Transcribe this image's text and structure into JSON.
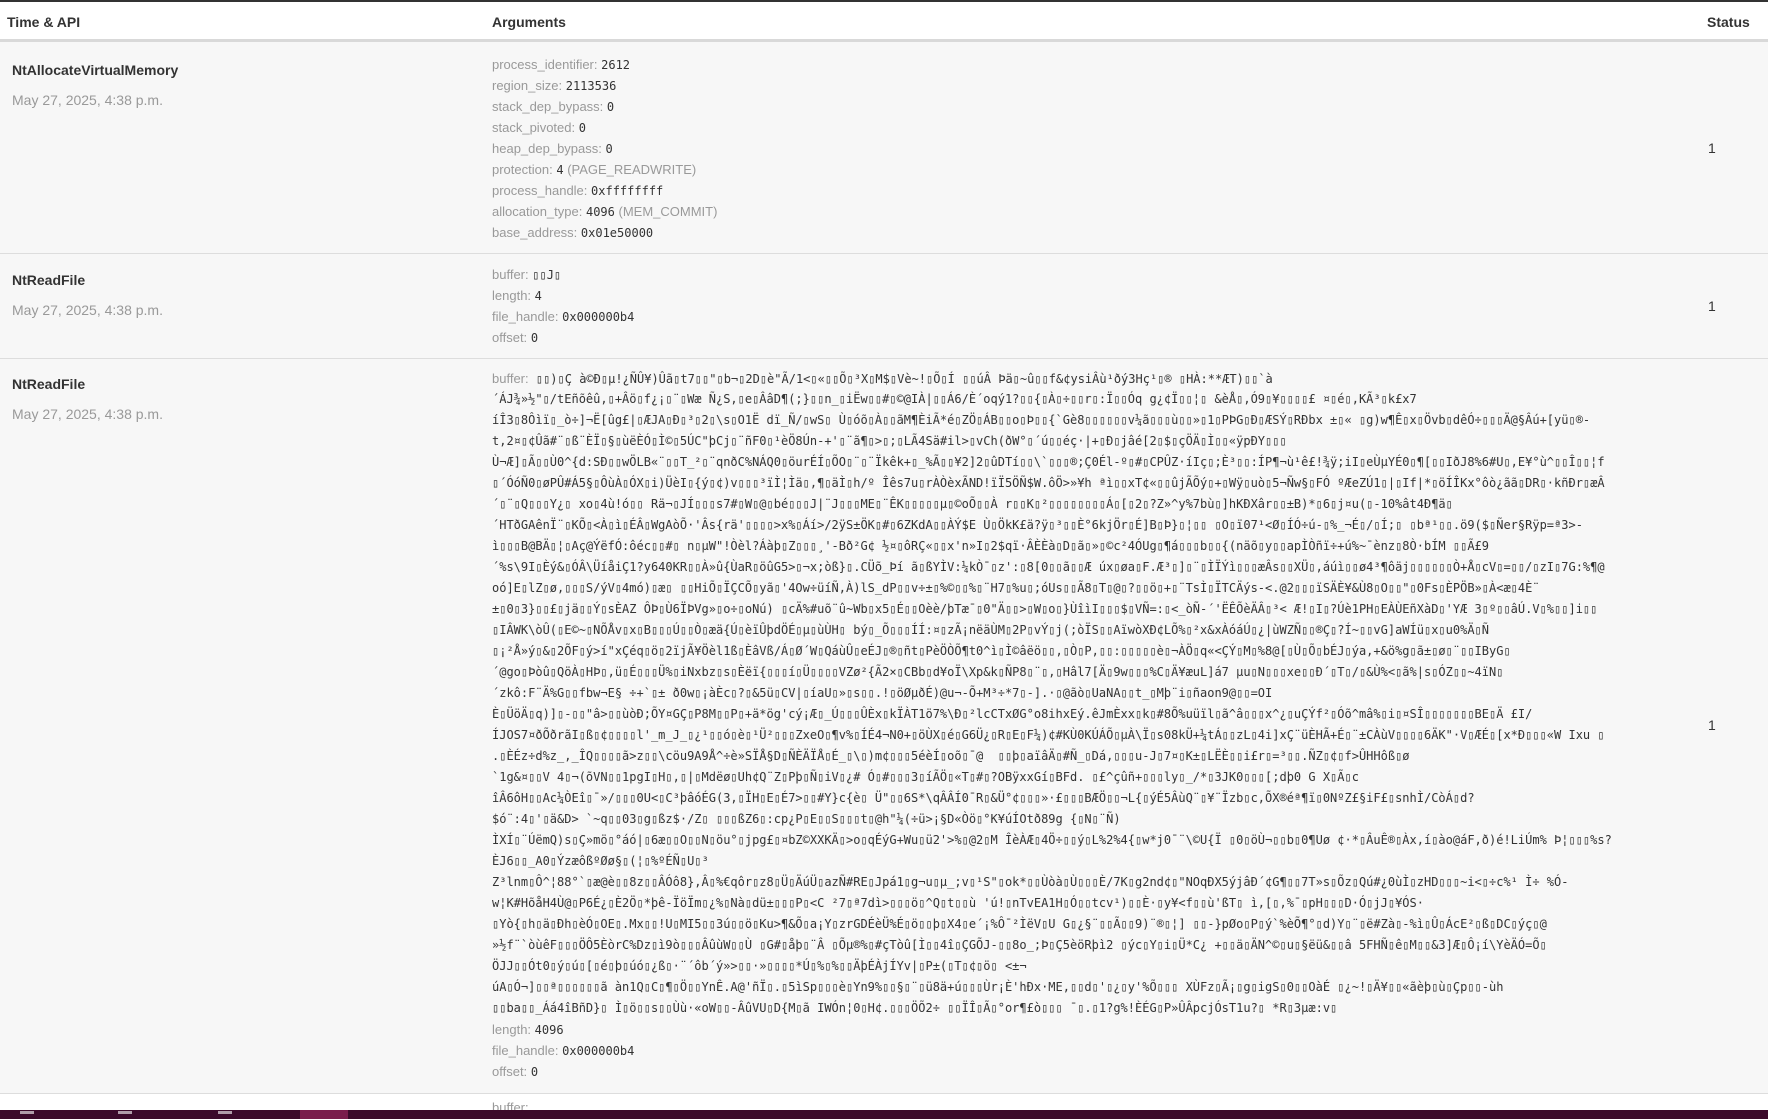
{
  "table": {
    "headers": {
      "time_api": "Time & API",
      "arguments": "Arguments",
      "status": "Status"
    }
  },
  "rows": [
    {
      "api": "NtAllocateVirtualMemory",
      "time": "May 27, 2025, 4:38 p.m.",
      "status": "1",
      "args": [
        {
          "key": "process_identifier:",
          "value": "2612",
          "desc": ""
        },
        {
          "key": "region_size:",
          "value": "2113536",
          "desc": ""
        },
        {
          "key": "stack_dep_bypass:",
          "value": "0",
          "desc": ""
        },
        {
          "key": "stack_pivoted:",
          "value": "0",
          "desc": ""
        },
        {
          "key": "heap_dep_bypass:",
          "value": "0",
          "desc": ""
        },
        {
          "key": "protection:",
          "value": "4",
          "desc": "(PAGE_READWRITE)"
        },
        {
          "key": "process_handle:",
          "value": "0xffffffff",
          "desc": ""
        },
        {
          "key": "allocation_type:",
          "value": "4096",
          "desc": "(MEM_COMMIT)"
        },
        {
          "key": "base_address:",
          "value": "0x01e50000",
          "desc": ""
        }
      ]
    },
    {
      "api": "NtReadFile",
      "time": "May 27, 2025, 4:38 p.m.",
      "status": "1",
      "args": [
        {
          "key": "buffer:",
          "value": "▯▯J▯",
          "desc": ""
        },
        {
          "key": "length:",
          "value": "4",
          "desc": ""
        },
        {
          "key": "file_handle:",
          "value": "0x000000b4",
          "desc": ""
        },
        {
          "key": "offset:",
          "value": "0",
          "desc": ""
        }
      ]
    },
    {
      "api": "NtReadFile",
      "time": "May 27, 2025, 4:38 p.m.",
      "status": "1",
      "buffer_key": "buffer:",
      "buffer_lines": [
        "▯▯)▯Ç à©Ð▯µ!¿ÑÛ¥)Ûã▯t7▯▯\"▯b¬▯2D▯è\"Ã/1<▯«▯▯Õ▯³X▯M$▯Vè~!▯Õ▯Í ▯▯úÂ Þä▯~û▯▯f&¢ysiÂù¹ðý3Hç¹▯® ▯HÀ:**ÆT)▯▯`à",
        "´ÁJ¾»½\"▯/tEñõêû,▯+Âö▯f¿¡▯¨▯Wæ Ñ¿S,▯e▯ÂâD¶(;}▯▯n_▯iËw▯▯#▯©@IÀ|▯▯Á6/È´oqý1?▯▯{▯À▯÷▯▯r▯:Ï▯▯Óq g¿¢Ï▯▯¦▯ &èÅ▯,Ó9▯¥▯▯▯▯£ ¤▯é▯,KÃ³▯k£x7",
        "íÎ3▯8Ôìï▯_ò÷]¬Ë[ûg£|▯ÆJA▯Ð▯³▯2▯\\s▯O1Ë dï_Ñ/▯wS▯ Ù▯óõ▯À▯▯ãM¶ÈiÃ*é▯ZÖ▯ÁB▯▯o▯Þ▯▯{`Gè8▯▯▯▯▯▯v¼ã▯▯▯ù▯▯»▯1▯PÞG▯Ð▯ÆSÝ▯RÐbx ±▯« ▯g)w¶Ê▯x▯Övb▯dêÓ÷▯▯▯Ä@§Âú+[yü▯®-",
        "t,2¤▯¢Ûã#¨▯ß¨ÈÏ▯§▯ùëÈÓ▯Ì©▯5ÚC\"þCj▯¨ñF0▯¹èÖ8Ún-+'▯¨ã¶▯>▯;▯LÃ4Sä#il>▯vCh(ðW°▯´ú▯▯éç·|+▯Ð▯jâé[2▯$▯çÖÄ▯Ì▯▯«ÿpÐY▯▯▯",
        "Ù¬Æ]▯Ã▯▯Ù0^{d:SÐ▯▯wÖLB«¨▯▯T_²▯¨qnðC%NÁQ0▯öurÉÍ▯ÕO▯¨▯¨Ïkêk+▯_%Ã▯▯¥2]2▯ûDTí▯▯\\`▯▯▯®;Ç0Él-º▯#▯CPÛZ·íIç▯;È³▯▯:ÍP¶¬ù¹ê£!¾ÿ;iI▯eÙµYÉ0▯¶[▯▯IðJ8%6#U▯,E¥°ù^▯▯Î▯▯¦f",
        "▯´ÓóÑ0▯øPÛ#Á5§▯ÔùÀ▯ÓX▯i)ÜèI▯{ý▯¢)v▯▯▯³ïÌ¦Ìä▯,¶▯äÌ▯h/º Îês7u▯rÀÒèxÃND!ïÏ5ÖÑ$W.ôÖ>»¥h ªì▯▯xT¢«▯▯ûjÃÕý▯+▯Wÿ▯uò▯5¬Ñw§▯FÓ ºÆeZÚ1▯|▯If|*▯öÍÎKx°ôò¿ãã▯DR▯·kñÐr▯æÂ",
        "´▯¨▯Q▯▯▯Y¿▯ xo▯4ù!ó▯▯ Rä¬▯JÍ▯▯▯s7#▯W▯@▯bé▯▯▯J|¨J▯▯▯ME▯¨ÊK▯▯▯▯▯µ▯©oÕ▯▯À r▯▯K▯²▯▯▯▯▯▯▯▯Á▯[▯2▯?Z»^y%7bù▯]hKÐXâr▯▯±B)*▯6▯j¤u(▯-10%ât4Ð¶ä▯",
        "´HTðGAênÏ¨▯KÕ▯<À▯ì▯ÉÂ▯WgAòÕ·'Âs{rä'▯▯▯▯>x%▯Áí>/2ÿS±ÖK▯#▯6ZKdA▯▯ÀÝ$E Ù▯ÖkK£ä?ÿ▯³▯▯È°6kjÖr▯É]B▯Þ}▯¦▯▯ ▯O▯ï07¹<Ø▯ÍÓ÷ú-▯%_¬É▯/▯Í;▯ ▯bª¹▯▯.ö9($▯Ñer§Rÿp=ª3>-",
        "ì▯▯▯B@BÄ▯¦▯Aç@ÝëfÓ:ôéc▯▯#▯ n▯µW\"!Òèl?Áàþ▯Z▯▯▯¸'-Bð²G¢ ½¤▯ôRÇ«▯▯x'n»I▯2$qï·ÂÈÈà▯D▯ã▯»▯©c²4ÓUg▯¶á▯▯▯b▯▯{(näõ▯y▯▯apÌÒñï÷+ú%~¯ènz▯8Ò·bÍM ▯▯Ã£9",
        "´%s\\9I▯Èý&▯ÓÂ\\ÜíåiÇ1?y640KR▯▯À»û{ÙaR▯öûG5>▯¬x;òß}▯.CÜõ_Þí ã▯ßYÌV:¼kÒ¯▯z':▯8[0▯▯ã▯▯Æ úx▯øa▯F.Æ³▯]▯¨▯ÌÏÝì▯▯▯æÂs▯▯XÜ▯,áúì▯▯ø4³¶ôäj▯▯▯▯▯▯Ò+Å▯cV▯=▯▯/▯zI▯7G:%¶@",
        "oó]E▯lZ▯ø,▯▯▯S/ýV▯4mó)▯æ▯ ▯▯HiÕ▯ÏÇCÕ▯yã▯'4Ow÷üíÑ,À)lS_dP▯▯v÷±▯%©▯▯%▯¨H7▯%u▯;óUs▯▯Ã8▯T▯@▯?▯▯ö▯+▯¨TsÌ▯ÏTCÄýs-<.@2▯▯▯ïSÄÈ¥&Ù8▯O▯▯\"▯0Fs▯ÈPÖB»▯À<æ▯4È¨",
        "±▯0▯3}▯▯£▯jä▯▯Ý▯sÈAZ ÔÞ▯Ù6ÏÞVg»▯o÷▯oNú) ▯cÄ%#uõ¨û~Wb▯x5▯É▯▯Oèè/þTæ¯▯0\"Ä▯▯>▯W▯o▯}ÙîìI▯▯▯$▯VÑ=:▯<_òÑ-´'ËÊÕèÄÂ▯³< Æ!▯I▯?Úè1PH▯EÀÙEñXàD▯'YÆ 3▯º▯▯âÚ.V▯%▯▯]i▯▯",
        "▯IÂWK\\òÛ(▯E©~▯NÕÅv▯x▯B▯▯▯Ú▯▯Ò▯æä{Ú▯èïÛþdÖÉ▯µ▯ùÙH▯ bý▯_Õ▯▯▯ÍÍ:¤▯zÃ¡nëäÙM▯2P▯vÝ▯j(;òÏS▯▯AïwòXÐ¢LÕ%▯²x&xÀóáÚ▯¿|ùWZÑ▯▯®Ç▯?Í~▯▯vG]aWÍü▯x▯u0%Ä▯Ñ",
        "▯¡²Å»ý▯&▯2ÕF▯ý>í\"xÇéq▯ö▯2ïjÃ¥Öèl1ß▯ÈâVß/Á▯Ø´W▯QáùÛ▯eÉJ▯®▯ñt▯PèÖÒÕ¶t0^ì▯Ì©âëö▯▯,▯Ò▯P,▯▯:▯▯▯▯▯è▯¬ÀÖ▯q«<ÇÝ▯M▯%8@[▯Ù▯Õ▯bÉJ▯ýa,+&ö%g▯ã±▯ø▯¨▯▯IByG▯",
        "´@go▯Þòû▯QöÀ▯HÞ▯,ü▯É▯▯▯Ü%▯iNxbz▯s▯Èëï{▯▯▯í▯Ü▯▯▯▯VZø²{Ã2×▯CBb▯d¥oÏ\\Xp&k▯ÑP8▯¨▯,▯Hâl7[Ä▯9w▯▯▯%C▯Ä¥æuL]á7 µu▯N▯▯▯xe▯▯Ð´▯T▯/▯&Ù%<▯ã%|s▯ÓZ▯▯~4ïN▯",
        "´zkô:F¨Ä%G▯▯fbw¬E§ ÷+`▯± ð0w▯¡àÈc▯?▯&5ü▯CV|▯íaU▯»▯s▯▯.!▯öØµðÉ)@u¬-Õ+M³÷*7▯-].·▯@ãò▯UaNA▯▯t_▯Mþ¨i▯ñaon9@▯▯=OI",
        "È▯ÜöÄ▯q)]▯-▯▯\"â>▯▯ùòÐ;ÕY¤GÇ▯P8M▯▯P▯+ä*ög'cý¡Æ▯_Ú▯▯▯ÛÈx▯kÏÀT1ö7%\\Ð▯²lcCTxØG°o8ihxEý.êJmÈxx▯k▯#8Õ%uüïl▯ã^â▯▯▯x^¿▯uÇÝf²▯Óõ^mâ%▯i▯¤SÎ▯▯▯▯▯▯▯BE▯Ä £I/",
        "ÍJOS7¤ðÕðrãI▯ß▯¢▯▯▯▯l'_m_J_▯¿¹▯▯ó▯è▯¹Ü²▯▯▯ZxeO▯¶v%▯ÍÉ4¬N0+▯öÙX▯é▯G6Ü¿▯R▯E▯F¼)¢#KÙ0KÚÁÕ▯µÀ\\Ï▯s08kÜ+¼tÁ▯▯zL▯4i]xÇ¨üÈHÃ+É▯¨±CÀùV▯▯▯▯6ÄK\"·V▯ÆÉ▯[x*Ð▯▯▯«W Ixu ▯",
        ".▯ÈÉz÷d%z_,_ÎQ▯▯▯▯ã>z▯▯\\cöu9A9Å^÷è»SÏÅ§D▯ÑÈÄÏÅ▯É_▯\\▯)m¢▯▯▯5éèÍ▯oõ▯¯@  ▯▯þ▯aïâÄ▯#Ñ_▯Dá,▯▯▯u-J▯7¤▯K±▯LËÈ▯▯i£r▯=³▯▯.ÑZ▯¢▯f>ÛHHôß▯ø",
        "`1g&¤▯▯V 4▯¬(õVN▯▯1pgI▯H▯,▯|▯Mdëø▯Uh¢Q¨Z▯Pþ▯Ñ▯iV▯¿# Ó▯#▯▯▯3▯íÃÖ▯«T▯#▯?OBÿxxGí▯BFd. ▯£^çûñ+▯▯▯ly▯_/*▯3JK0▯▯▯[;dþ0 G X▯Ã▯c",
        "îÂ6ôH▯▯Ac¼ÒEî▯¯»/▯▯▯0U<▯C³þâóÉG(3,▯ÏH▯E▯É7>▯▯#Y}c{è▯ Ü\"▯▯6S*\\qÂÂÍ0¯R▯&Ü°¢▯▯▯»·£▯▯▯BÆÖ▯▯¬L{▯ýÉ5ÂùQ¨▯¥¨Ïzb▯c,ÕX®éª¶ï▯0NºZ£§iF£▯snhÌ/CòÁ▯d?",
        "$ó¨:4▯'▯ä&D> `~q▯▯03▯g▯ßz$·/Z▯ ▯▯▯ßZ6▯:cp¿P▯E▯▯S▯▯▯t▯@h\"¼(÷ü>¡§D«Òö▯°K¥úÍOtð89g {▯N▯¨Ñ)",
        "ÌXÍ▯¨ÚëmQ)s▯Ç»mö▯°áó|▯6æ▯▯O▯▯N▯öu°▯jpg£▯¤bZ©XXKÄ▯>o▯qÉýG+Wu▯ü2'>%▯@2▯M ÎèÀÆ▯4Ö÷▯▯ý▯L%2%4{▯w*j0¯¨\\©U{Ï ▯0▯öÙ¬▯▯b▯0¶Uø ¢·*▯ÂuÊ®▯Àx,í▯ào@áF,ð)é!LiÚm% Þ¦▯▯▯%s?",
        "ÈJ6▯▯_A0▯ÝzæôßºØø§▯(¦▯%ºÉÑ▯U▯³",
        "Z³lnm▯Ô^¦88°`▯æ@è▯▯8z▯▯ÂÓô8},Â▯%€qôr▯z8▯Ü▯ÄúÜ▯azÑ#RE▯Jpá1▯g¬u▯µ_;v▯¹S\"▯ok*▯▯Ùòà▯Ù▯▯▯È/7K▯g2nd¢▯\"NOqÐX5ýjâÐ´¢G¶▯▯7T»s▯Õz▯Qú#¿0ùÌ▯zHD▯▯▯~i<▯÷c%¹ Ì÷ %Ó-",
        "w¦K#HõåH4Ù@▯P6É¿▯È2Ö▯*þê-ÏöÏm▯¿%▯Nà▯dü±▯▯▯P▯<C ²7▯ª7dì>▯▯▯ö▯^Q▯t▯▯ù 'ú!▯nTvEA1H▯Ó▯▯tcv¹)▯▯È·▯y¥<f▯▯ù'ßT▯ ì,[▯,%¯▯pH▯▯▯D·Ó▯jJ▯¥ÓS·",
        "▯Yò{▯h▯ä▯Ðh▯èÓ▯OE▯.Mx▯▯!U▯MI5▯▯3ú▯▯ö▯Ku>¶&Õ▯a¡Y▯zrGDÉèÜ%É▯ö▯▯þ▯X4▯e´¡%Ô¯²ÌëV▯U G▯¿§¨▯▯Ã▯▯9)¨®▯¦] ▯▯-}pØo▯P▯ý`%èÕ¶°▯d)Y▯¨▯ë#Zà▯-%ì▯Û▯ÁcE²▯ß▯DC▯ýç▯@",
        "»½f¨`òùêF▯▯▯ÖÔ5ÈòrC%Dz▯ì9ò▯▯▯ÂûùW▯▯Ù ▯G#▯åþ▯¨Â ▯Õµ®%▯#çTòû[Ì▯▯4î▯ÇGÕJ-▯▯8o_;Þ▯Ç5èöRþì2 ▯ýc▯Y▯i▯Ü*C¿ +▯▯ä▯ÄN^©▯u▯§ëü&▯▯â 5FHÑ▯ê▯M▯▯&3]Æ▯Ô¡í\\YèÄÓ=Õ▯",
        "ÖJJ▯▯Ót0▯ý▯ú▯[▯é▯þ▯úó▯¿ß▯·¨´ôb´ý»>▯▯·»▯▯▯▯*Ú▯%▯%▯▯ÄþÉÀjÍYv|▯P±(▯T▯¢▯ö▯ <±¬",
        "úA▯Ó¬]▯▯ª▯▯▯▯▯▯ã àn1Q▯C▯¶▯Ö▯▯YnÊ.A@'ñÏ▯.▯5ìSp▯▯▯è▯Yn9%▯▯§▯¨▯ü8ä+ú▯▯▯Ùr¡È'hÐx·ME,▯▯d▯'▯¿▯y'%Õ▯▯▯ XÙFz▯Ã¡▯g▯igS▯0▯▯OàÉ ▯¿~!▯Ä¥▯▯«ãèþ▯ù▯Çp▯▯-ùh",
        "▯▯ba▯▯_Áá4îBñD}▯ Ì▯ö▯▯s▯▯Ùù·«oW▯▯-ÂûVU▯D{M▯ã IWÓn¦0▯H¢.▯▯▯ÖÕ2÷ ▯▯ÏÎ▯Ã▯°or¶£ò▯▯▯ ¯▯.▯1?g%!ÈÉG▯P»ÛÂpcjÓsT1u?▯ *R▯3µæ:v▯"
      ],
      "args_after": [
        {
          "key": "length:",
          "value": "4096",
          "desc": ""
        },
        {
          "key": "file_handle:",
          "value": "0x000000b4",
          "desc": ""
        },
        {
          "key": "offset:",
          "value": "0",
          "desc": ""
        }
      ]
    }
  ],
  "partial_row": {
    "text": "buffer: ..."
  }
}
